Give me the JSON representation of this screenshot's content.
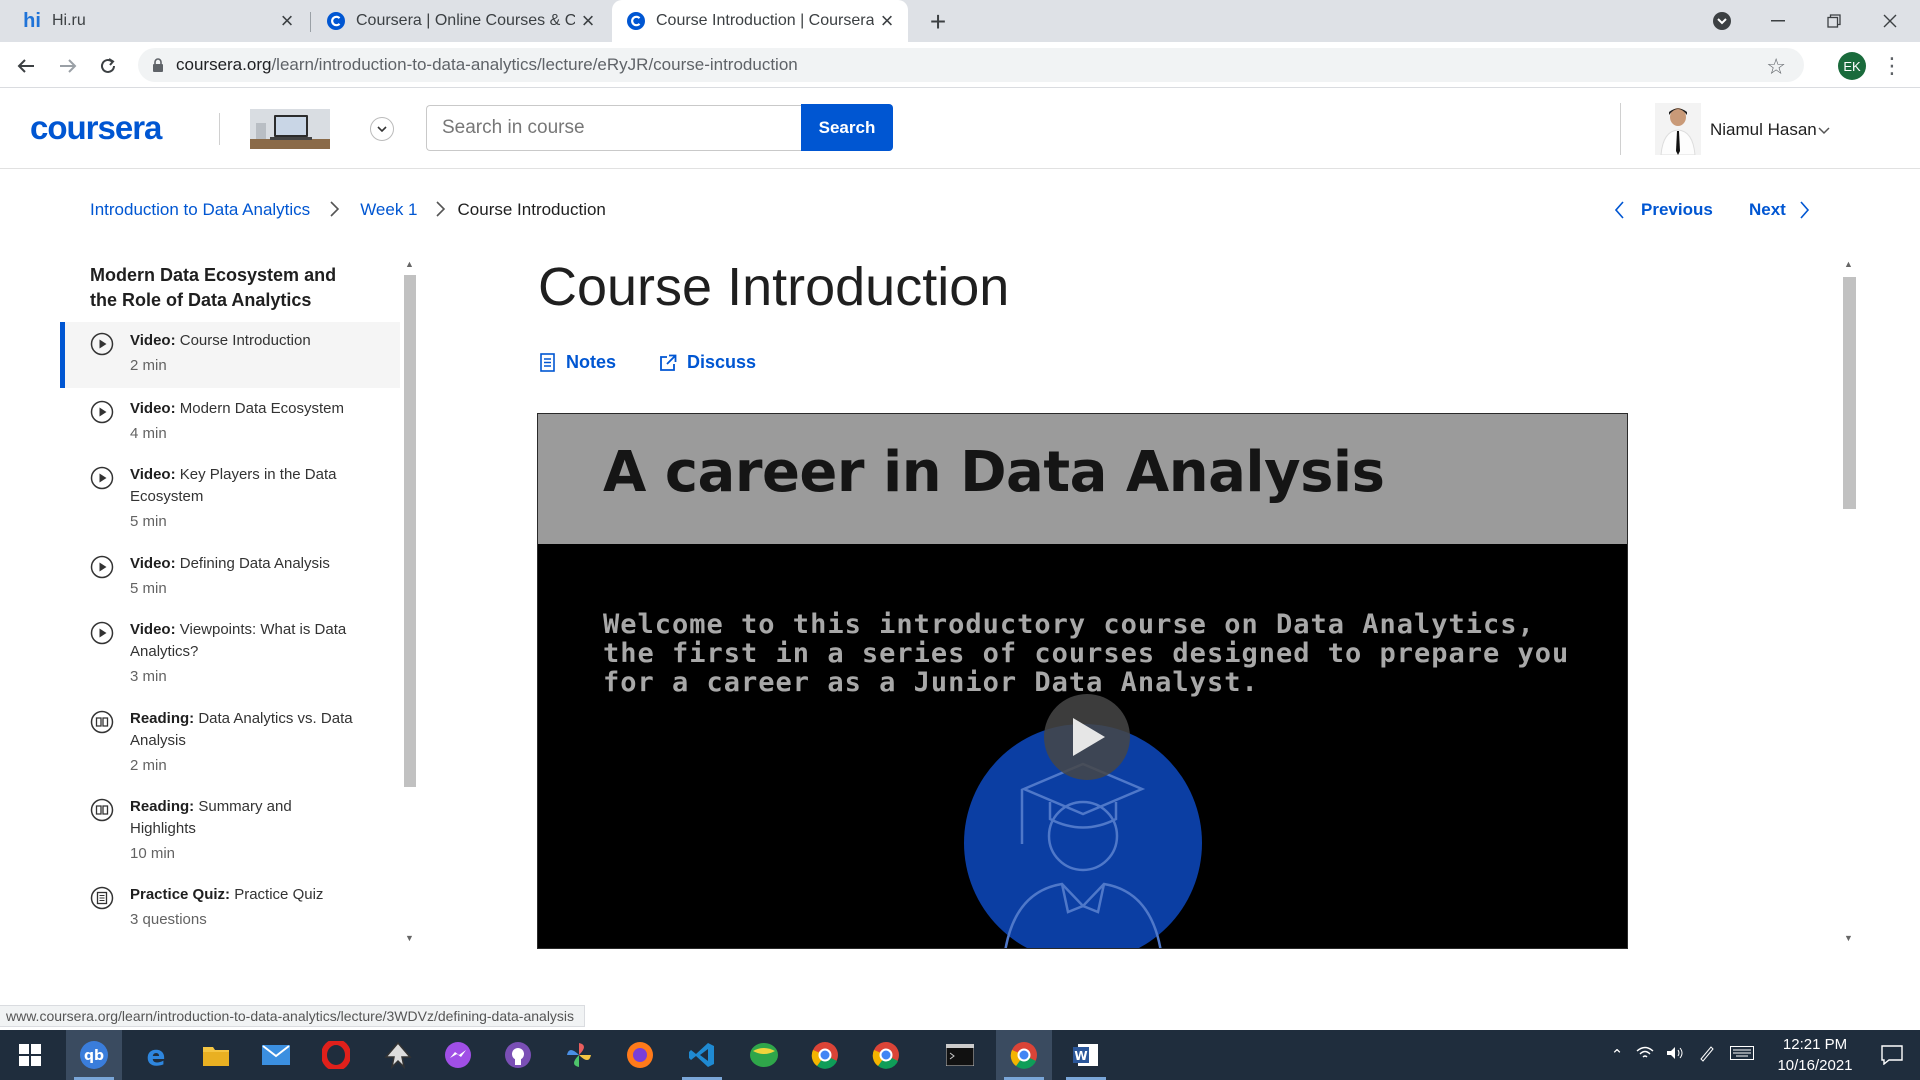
{
  "browser": {
    "tabs": [
      {
        "title": "Hi.ru",
        "favicon": "hi-logo-icon",
        "active": false
      },
      {
        "title": "Coursera | Online Courses & Crec",
        "favicon": "coursera-icon",
        "active": false
      },
      {
        "title": "Course Introduction | Coursera",
        "favicon": "coursera-icon",
        "active": true
      }
    ],
    "url_host": "coursera.org",
    "url_path": "/learn/introduction-to-data-analytics/lecture/eRyJR/course-introduction",
    "profile_initials": "EK",
    "status_url": "www.coursera.org/learn/introduction-to-data-analytics/lecture/3WDVz/defining-data-analysis"
  },
  "header": {
    "logo": "coursera",
    "search_placeholder": "Search in course",
    "search_button": "Search",
    "user_name": "Niamul Hasan"
  },
  "breadcrumb": {
    "course": "Introduction to Data Analytics",
    "week": "Week 1",
    "current": "Course Introduction"
  },
  "pager": {
    "previous": "Previous",
    "next": "Next"
  },
  "sidebar": {
    "module_title": "Modern Data Ecosystem and the Role of Data Analytics",
    "items": [
      {
        "type": "Video:",
        "title": "Course Introduction",
        "duration": "2 min",
        "icon": "play-circle-icon",
        "active": true
      },
      {
        "type": "Video:",
        "title": "Modern Data Ecosystem",
        "duration": "4 min",
        "icon": "play-circle-icon"
      },
      {
        "type": "Video:",
        "title": "Key Players in the Data Ecosystem",
        "duration": "5 min",
        "icon": "play-circle-icon"
      },
      {
        "type": "Video:",
        "title": "Defining Data Analysis",
        "duration": "5 min",
        "icon": "play-circle-icon"
      },
      {
        "type": "Video:",
        "title": "Viewpoints: What is Data Analytics?",
        "duration": "3 min",
        "icon": "play-circle-icon"
      },
      {
        "type": "Reading:",
        "title": "Data Analytics vs. Data Analysis",
        "duration": "2 min",
        "icon": "book-icon"
      },
      {
        "type": "Reading:",
        "title": "Summary and Highlights",
        "duration": "10 min",
        "icon": "book-icon"
      },
      {
        "type": "Practice Quiz:",
        "title": "Practice Quiz",
        "duration": "3 questions",
        "icon": "quiz-icon"
      }
    ]
  },
  "main": {
    "title": "Course Introduction",
    "notes_label": "Notes",
    "discuss_label": "Discuss",
    "video": {
      "heading": "A career in Data Analysis",
      "body": "Welcome to this introductory course on Data Analytics, the first in a series of courses designed to prepare you for a career as a Junior Data Analyst."
    }
  },
  "taskbar": {
    "time": "12:21 PM",
    "date": "10/16/2021"
  },
  "colors": {
    "brand": "#0056d2",
    "tabbar": "#dee1e6",
    "taskbar": "#1f2d3d"
  }
}
